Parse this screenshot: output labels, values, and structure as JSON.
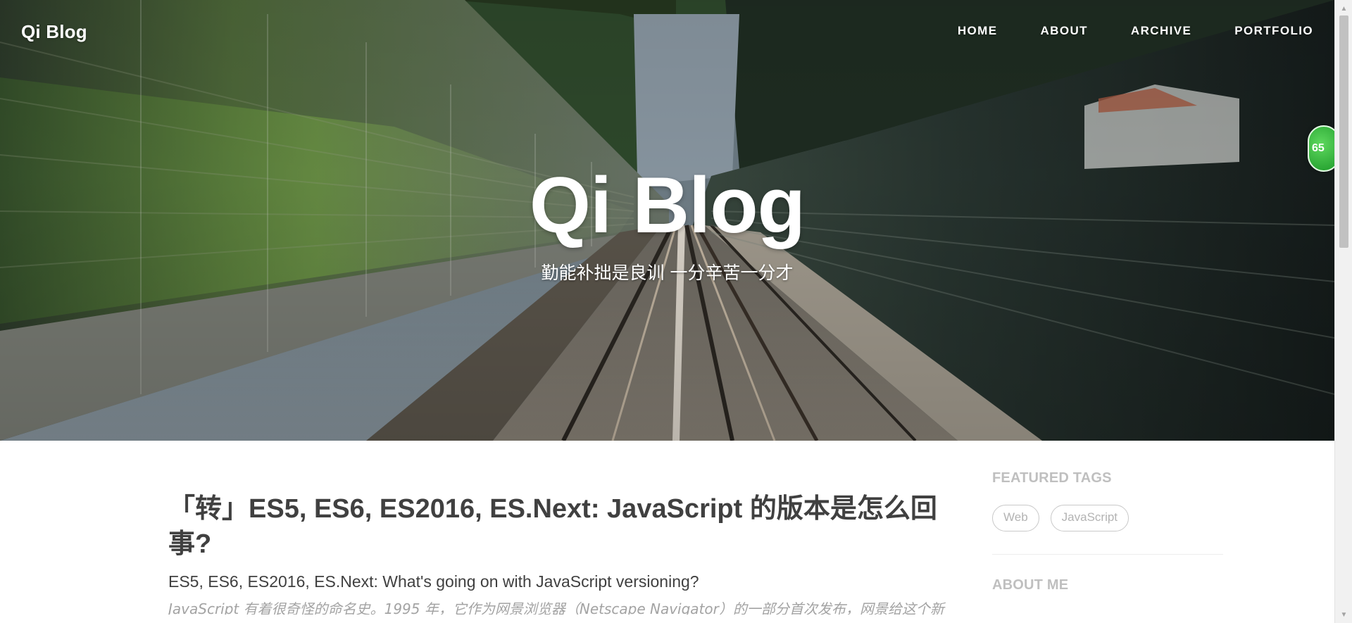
{
  "header": {
    "brand": "Qi Blog",
    "nav": [
      "HOME",
      "ABOUT",
      "ARCHIVE",
      "PORTFOLIO"
    ]
  },
  "hero": {
    "title": "Qi Blog",
    "subtitle": "勤能补拙是良训 一分辛苦一分才"
  },
  "floating_badge": {
    "text": "65"
  },
  "post": {
    "title": "「转」ES5, ES6, ES2016, ES.Next: JavaScript 的版本是怎么回事?",
    "subtitle": "ES5, ES6, ES2016, ES.Next: What's going on with JavaScript versioning?",
    "excerpt": "JavaScript 有着很奇怪的命名史。1995 年，它作为网景浏览器（Netscape Navigator）的一部分首次发布，网景给这个新"
  },
  "sidebar": {
    "featured_tags_heading": "FEATURED TAGS",
    "tags": [
      "Web",
      "JavaScript"
    ],
    "about_heading": "ABOUT ME"
  },
  "colors": {
    "text_dark": "#404040",
    "text_muted": "#a3a3a3",
    "sidebar_heading": "#bfbfbf",
    "badge_green": "#1e9b2a"
  }
}
